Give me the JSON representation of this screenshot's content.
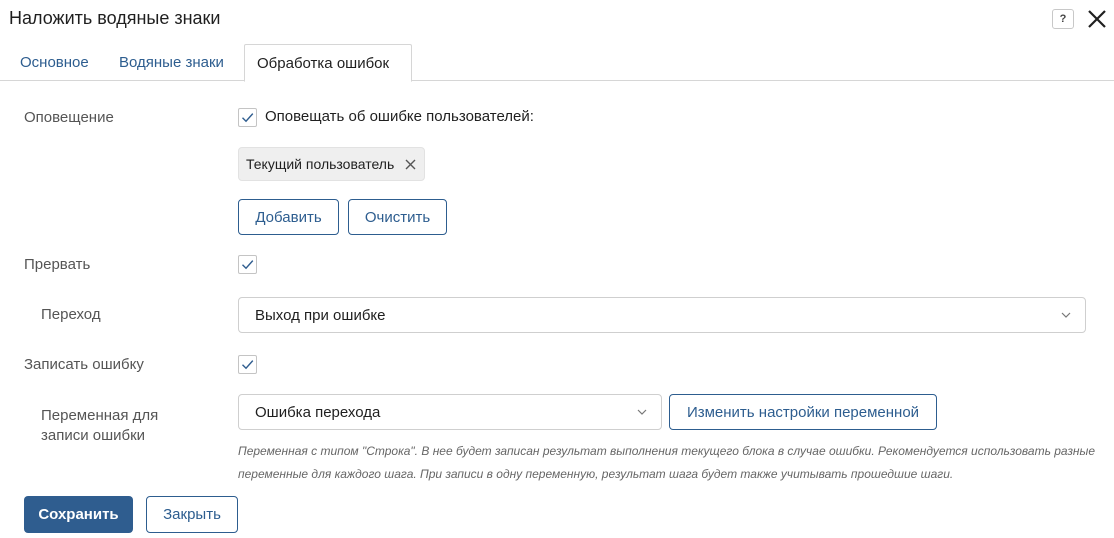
{
  "window": {
    "title": "Наложить водяные знаки",
    "help_label": "?"
  },
  "tabs": [
    {
      "label": "Основное",
      "active": false
    },
    {
      "label": "Водяные знаки",
      "active": false
    },
    {
      "label": "Обработка ошибок",
      "active": true
    }
  ],
  "notification": {
    "label": "Оповещение",
    "checkbox_label": "Оповещать об ошибке пользователей:",
    "checked": true,
    "chip_label": "Текущий пользователь",
    "add_button": "Добавить",
    "clear_button": "Очистить"
  },
  "interrupt": {
    "label": "Прервать",
    "checked": true
  },
  "transition": {
    "label": "Переход",
    "value": "Выход при ошибке"
  },
  "log_error": {
    "label": "Записать ошибку",
    "checked": true
  },
  "error_variable": {
    "label_line1": "Переменная для",
    "label_line2": "записи ошибки",
    "value": "Ошибка перехода",
    "change_button": "Изменить настройки переменной",
    "hint": "Переменная с типом \"Строка\". В нее будет записан результат выполнения текущего блока в случае ошибки. Рекомендуется использовать разные переменные для каждого шага. При записи в одну переменную, результат шага будет также учитывать прошедшие шаги."
  },
  "footer": {
    "save_button": "Сохранить",
    "close_button": "Закрыть"
  },
  "colors": {
    "accent": "#2f5d8f",
    "tab_link": "#2d5d8f",
    "label": "#555555"
  }
}
